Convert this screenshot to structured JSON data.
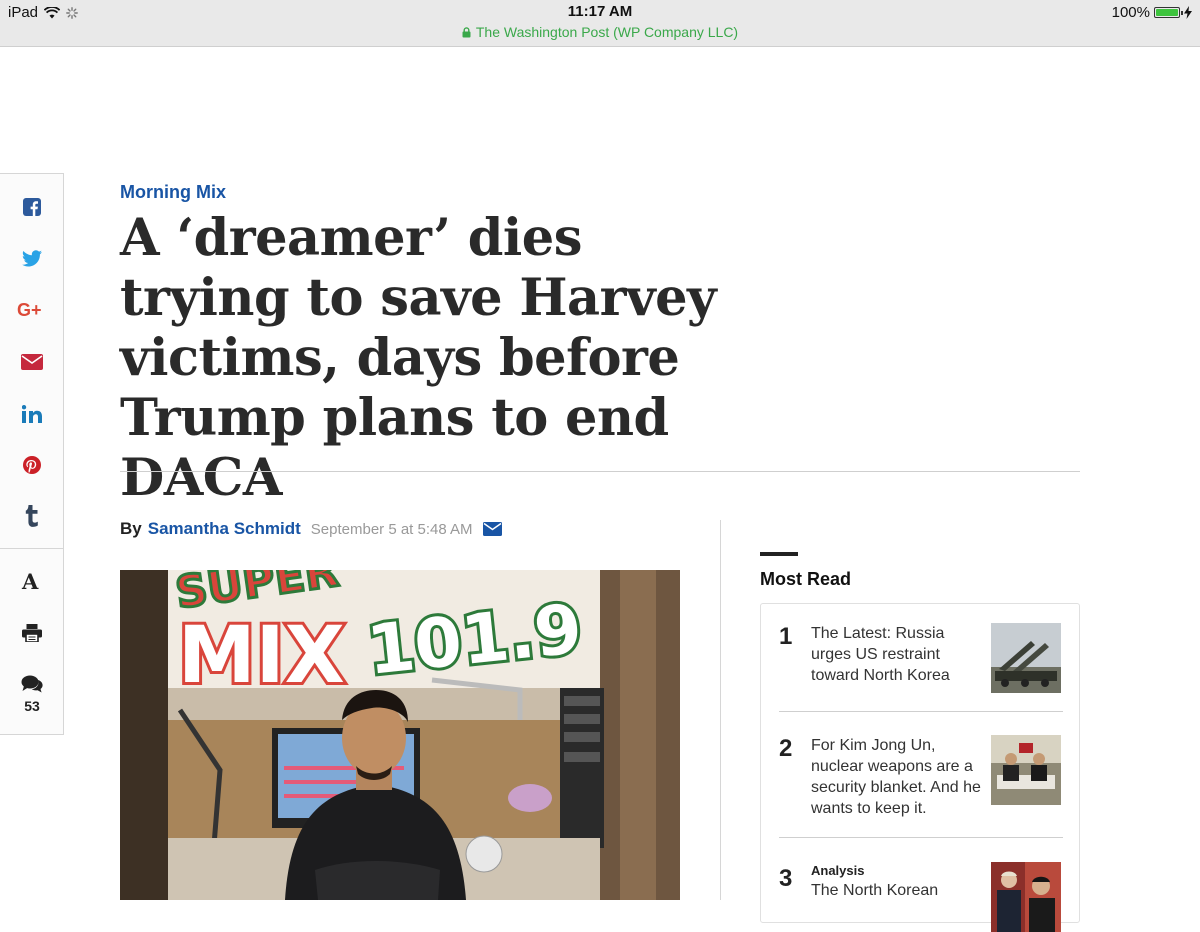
{
  "status_bar": {
    "device": "iPad",
    "time": "11:17 AM",
    "site": "The Washington Post (WP Company LLC)",
    "battery": "100%",
    "battery_level": 1.0
  },
  "share": {
    "icons": [
      "facebook-icon",
      "twitter-icon",
      "google-plus-icon",
      "email-icon",
      "linkedin-icon",
      "pinterest-icon",
      "tumblr-icon",
      "text-size-icon",
      "print-icon",
      "comment-icon"
    ],
    "comment_count": "53"
  },
  "article": {
    "kicker": "Morning Mix",
    "headline": "A ‘dreamer’ dies trying to save Harvey victims, days before Trump plans to end DACA",
    "byline_prefix": "By",
    "author": "Samantha Schmidt",
    "date": "September 5 at 5:48 AM"
  },
  "most_read": {
    "heading": "Most Read",
    "items": [
      {
        "rank": "1",
        "label": "",
        "title": "The Latest: Russia urges US restraint toward North Korea"
      },
      {
        "rank": "2",
        "label": "",
        "title": "For Kim Jong Un, nuclear weapons are a security blanket. And he wants to keep it."
      },
      {
        "rank": "3",
        "label": "Analysis",
        "title": "The North Korean"
      }
    ]
  },
  "colors": {
    "link_blue": "#1955a5",
    "ssl_green": "#3aa84a",
    "facebook": "#2d5a9c",
    "twitter": "#2aa3e6",
    "google_plus": "#dc4a38",
    "email": "#c5283d",
    "linkedin": "#1a7bb9",
    "pinterest": "#cb2027",
    "tumblr": "#35465c"
  }
}
